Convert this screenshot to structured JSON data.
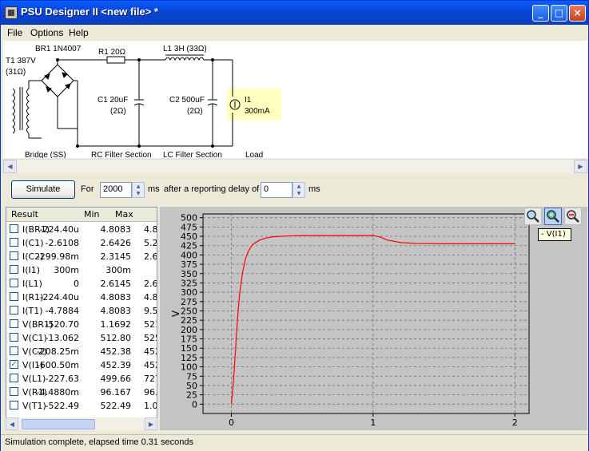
{
  "window": {
    "title": "PSU Designer II  <new file> *",
    "minimize": "_",
    "maximize": "□",
    "close": "×"
  },
  "menu": [
    "File",
    "Options",
    "Help"
  ],
  "schematic": {
    "transformer_label": "T1 387V",
    "transformer_res": "(31Ω)",
    "bridge_label": "BR1 1N4007",
    "resistor_label": "R1 20Ω",
    "inductor_label": "L1 3H (33Ω)",
    "c1_label": "C1 20uF",
    "c1_res": "(2Ω)",
    "c2_label": "C2 500uF",
    "c2_res": "(2Ω)",
    "load_label": "I1",
    "load_value": "300mA",
    "section_bridge": "Bridge (SS)",
    "section_rc": "RC Filter Section",
    "section_lc": "LC Filter Section",
    "section_load": "Load"
  },
  "simulation": {
    "button": "Simulate",
    "for_label": "For",
    "duration": "2000",
    "ms1": "ms",
    "delay_label": "after a reporting delay of",
    "delay": "0",
    "ms2": "ms"
  },
  "results": {
    "headers": [
      "Result",
      "Min",
      "Max"
    ],
    "rows": [
      {
        "name": "I(BR1)",
        "min": "-224.40u",
        "max": "4.8083",
        "extra": "4.8",
        "checked": false
      },
      {
        "name": "I(C1)",
        "min": "-2.6108",
        "max": "2.6426",
        "extra": "5.2",
        "checked": false
      },
      {
        "name": "I(C2)",
        "min": "-299.98m",
        "max": "2.3145",
        "extra": "2.6",
        "checked": false
      },
      {
        "name": "I(I1)",
        "min": "300m",
        "max": "300m",
        "extra": "",
        "checked": false
      },
      {
        "name": "I(L1)",
        "min": "0",
        "max": "2.6145",
        "extra": "2.6",
        "checked": false
      },
      {
        "name": "I(R1)",
        "min": "-224.40u",
        "max": "4.8083",
        "extra": "4.8",
        "checked": false
      },
      {
        "name": "I(T1)",
        "min": "-4.7884",
        "max": "4.8083",
        "extra": "9.5",
        "checked": false
      },
      {
        "name": "V(BR1)",
        "min": "-520.70",
        "max": "1.1692",
        "extra": "521",
        "checked": false
      },
      {
        "name": "V(C1)",
        "min": "-13.062",
        "max": "512.80",
        "extra": "525",
        "checked": false
      },
      {
        "name": "V(C2)",
        "min": "-208.25m",
        "max": "452.38",
        "extra": "452",
        "checked": false
      },
      {
        "name": "V(I1)",
        "min": "-600.50m",
        "max": "452.39",
        "extra": "452",
        "checked": true
      },
      {
        "name": "V(L1)",
        "min": "-227.63",
        "max": "499.66",
        "extra": "727",
        "checked": false
      },
      {
        "name": "V(R1)",
        "min": "-4.4880m",
        "max": "96.167",
        "extra": "96.",
        "checked": false
      },
      {
        "name": "V(T1)",
        "min": "-522.49",
        "max": "522.49",
        "extra": "1.04",
        "checked": false
      }
    ]
  },
  "plot": {
    "tooltip": "- V(I1)",
    "zoom_in_icon": "zoom-in-icon",
    "zoom_select_icon": "zoom-select-icon",
    "zoom_out_icon": "zoom-out-icon"
  },
  "chart_data": {
    "type": "line",
    "title": "",
    "xlabel": "",
    "ylabel": "V",
    "xlim": [
      -0.2,
      2.1
    ],
    "ylim": [
      -25,
      510
    ],
    "xticks": [
      "0",
      "1",
      "2"
    ],
    "yticks": [
      "0",
      "25",
      "50",
      "75",
      "100",
      "125",
      "150",
      "175",
      "200",
      "225",
      "250",
      "275",
      "300",
      "325",
      "350",
      "375",
      "400",
      "425",
      "450",
      "475",
      "500"
    ],
    "grid": true,
    "series": [
      {
        "name": "V(I1)",
        "color": "#ff0000",
        "x": [
          0,
          0.01,
          0.02,
          0.03,
          0.04,
          0.05,
          0.06,
          0.08,
          0.1,
          0.12,
          0.15,
          0.2,
          0.25,
          0.3,
          0.4,
          0.5,
          0.6,
          0.8,
          1.0,
          1.05,
          1.1,
          1.2,
          1.3,
          1.5,
          1.7,
          2.0
        ],
        "values": [
          0,
          40,
          90,
          150,
          210,
          260,
          300,
          355,
          390,
          410,
          428,
          440,
          446,
          449,
          451,
          452,
          452,
          452,
          452,
          448,
          440,
          433,
          431,
          430,
          430,
          430
        ]
      }
    ]
  },
  "status": "Simulation complete, elapsed time 0.31 seconds"
}
